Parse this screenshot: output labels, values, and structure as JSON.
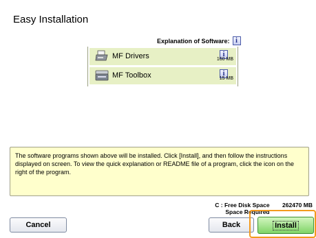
{
  "window": {
    "title": "Easy Installation"
  },
  "explanation": {
    "label": "Explanation of Software:"
  },
  "software": [
    {
      "name": "MF Drivers",
      "size": "160 MB",
      "icon": "printer-icon"
    },
    {
      "name": "MF Toolbox",
      "size": "15 MB",
      "icon": "scanner-icon"
    }
  ],
  "description": "The software programs shown above will be installed. Click [Install], and then follow the instructions displayed on screen. To view the quick explanation or README file of a program, click the icon on the right of the program.",
  "disk": {
    "free_label": "C : Free Disk Space",
    "free_value": "262470 MB",
    "required_label": "Space Required"
  },
  "buttons": {
    "cancel": "Cancel",
    "back": "Back",
    "install": "Install"
  },
  "colors": {
    "list_bg": "#e7f0c5",
    "desc_bg": "#ffffcc",
    "highlight": "#f39a1d",
    "install_bg": "#7fd467"
  }
}
